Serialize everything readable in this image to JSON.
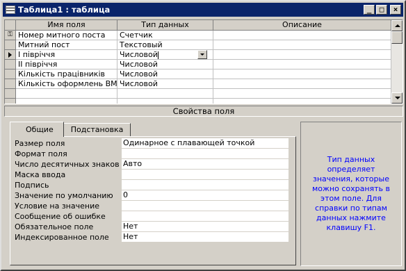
{
  "window": {
    "title": "Таблица1 : таблица",
    "buttons": {
      "minimize": "_",
      "maximize": "□",
      "close": "×"
    }
  },
  "grid": {
    "columns": [
      "Имя поля",
      "Тип данных",
      "Описание"
    ],
    "rows": [
      {
        "name": "Номер митного поста",
        "type": "Счетчик",
        "desc": "",
        "indicator": "key-icon"
      },
      {
        "name": "Митний пост",
        "type": "Текстовый",
        "desc": "",
        "indicator": ""
      },
      {
        "name": "I півріччя",
        "type": "Числовой",
        "desc": "",
        "indicator": "current-row-arrow-icon"
      },
      {
        "name": "II півріччя",
        "type": "Числовой",
        "desc": "",
        "indicator": ""
      },
      {
        "name": "Кількість працівників",
        "type": "Числовой",
        "desc": "",
        "indicator": ""
      },
      {
        "name": "Кількість оформлень ВМД",
        "type": "Числовой",
        "desc": "",
        "indicator": ""
      },
      {
        "name": "",
        "type": "",
        "desc": "",
        "indicator": ""
      },
      {
        "name": "",
        "type": "",
        "desc": "",
        "indicator": ""
      }
    ]
  },
  "properties": {
    "section_title": "Свойства поля",
    "tabs": [
      "Общие",
      "Подстановка"
    ],
    "active_tab": "Общие",
    "rows": [
      {
        "label": "Размер поля",
        "value": "Одинарное с плавающей точкой"
      },
      {
        "label": "Формат поля",
        "value": ""
      },
      {
        "label": "Число десятичных знаков",
        "value": "Авто"
      },
      {
        "label": "Маска ввода",
        "value": ""
      },
      {
        "label": "Подпись",
        "value": ""
      },
      {
        "label": "Значение по умолчанию",
        "value": "0"
      },
      {
        "label": "Условие на значение",
        "value": ""
      },
      {
        "label": "Сообщение об ошибке",
        "value": ""
      },
      {
        "label": "Обязательное поле",
        "value": "Нет"
      },
      {
        "label": "Индексированное поле",
        "value": "Нет"
      }
    ],
    "help_text": "Тип данных определяет значения, которые можно сохранять в этом поле. Для справки по типам данных нажмите клавишу F1."
  },
  "colors": {
    "titlebar": "#0a246a",
    "face": "#d4d0c8",
    "help_text": "#0000ff"
  }
}
